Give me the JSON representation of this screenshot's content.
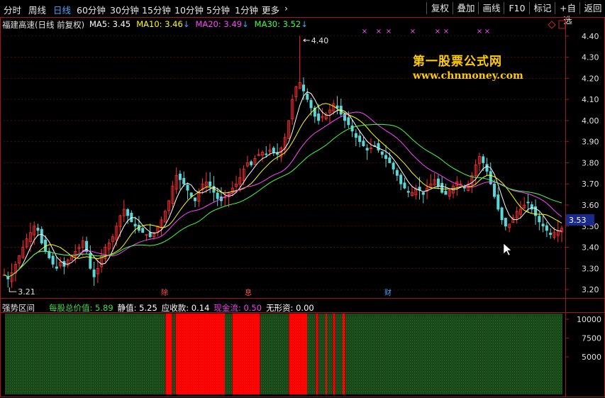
{
  "toolbar": {
    "tabs": [
      "分时",
      "周线",
      "日线",
      "60分钟",
      "30分钟",
      "15分钟",
      "10分钟",
      "5分钟",
      "1分钟",
      "更多"
    ],
    "active_tab": "日线",
    "more_arrow": "›",
    "right_buttons": [
      "复权",
      "叠加",
      "画线",
      "F10",
      "标记",
      "+自选",
      "返回"
    ]
  },
  "legend": {
    "stock": "福建高速(日线 前复权)",
    "ma": [
      {
        "label": "MA5:",
        "value": "3.45",
        "color": "#ffffff",
        "arrow": ""
      },
      {
        "label": "MA10:",
        "value": "3.46",
        "color": "#ffff00",
        "arrow": "↓"
      },
      {
        "label": "MA20:",
        "value": "3.49",
        "color": "#ff44ff",
        "arrow": "↓"
      },
      {
        "label": "MA30:",
        "value": "3.52",
        "color": "#44ff44",
        "arrow": "↓"
      }
    ]
  },
  "watermark": {
    "line1": "第一股票公式网",
    "line2": "www.chnmoney.com"
  },
  "lower_panel": {
    "title": "强势区间",
    "items": [
      {
        "label": "每股总价值:",
        "value": "5.89",
        "color": "#44dd44"
      },
      {
        "label": "静值:",
        "value": "5.25",
        "color": "#ffffff"
      },
      {
        "label": "应收款:",
        "value": "0.14",
        "color": "#ffffff"
      },
      {
        "label": "现金流:",
        "value": "0.50",
        "color": "#ee44ee"
      },
      {
        "label": "无形资:",
        "value": "0.00",
        "color": "#ffffff"
      }
    ]
  },
  "colors": {
    "up": "#ff3030",
    "down": "#5ad8d8",
    "axis": "#9a1b1b",
    "grid": "#5a1212",
    "text": "#e0e0e0",
    "bar_green": "#2a7a2a",
    "bar_red": "#ff0000"
  },
  "chart_data": [
    {
      "type": "candlestick",
      "title": "福建高速",
      "ylim": [
        3.16,
        4.47
      ],
      "y_ticks": [
        3.2,
        3.3,
        3.4,
        3.5,
        3.6,
        3.7,
        3.8,
        3.9,
        4.0,
        4.1,
        4.2,
        4.3,
        4.4
      ],
      "current_price": "3.53",
      "annotations": [
        {
          "label": "4.40",
          "value": 4.4
        },
        {
          "label": "3.21",
          "value": 3.21
        }
      ],
      "event_markers": [
        "除",
        "息",
        "财"
      ],
      "ma_series": [
        {
          "name": "MA5",
          "value": 3.45
        },
        {
          "name": "MA10",
          "value": 3.46
        },
        {
          "name": "MA20",
          "value": 3.49
        },
        {
          "name": "MA30",
          "value": 3.52
        }
      ],
      "closes": [
        3.27,
        3.25,
        3.28,
        3.32,
        3.36,
        3.4,
        3.44,
        3.47,
        3.5,
        3.48,
        3.42,
        3.38,
        3.35,
        3.32,
        3.3,
        3.33,
        3.31,
        3.34,
        3.36,
        3.38,
        3.4,
        3.43,
        3.38,
        3.3,
        3.26,
        3.3,
        3.36,
        3.4,
        3.42,
        3.45,
        3.5,
        3.55,
        3.58,
        3.55,
        3.52,
        3.5,
        3.48,
        3.47,
        3.46,
        3.45,
        3.47,
        3.5,
        3.53,
        3.57,
        3.62,
        3.69,
        3.74,
        3.72,
        3.7,
        3.67,
        3.64,
        3.62,
        3.66,
        3.7,
        3.71,
        3.69,
        3.66,
        3.63,
        3.62,
        3.64,
        3.66,
        3.68,
        3.7,
        3.73,
        3.77,
        3.8,
        3.79,
        3.82,
        3.84,
        3.85,
        3.84,
        3.86,
        3.85,
        3.84,
        3.87,
        3.92,
        4.0,
        4.1,
        4.16,
        4.18,
        4.14,
        4.1,
        4.06,
        4.02,
        4.0,
        4.02,
        4.03,
        4.05,
        4.08,
        4.06,
        4.03,
        4.0,
        3.98,
        3.95,
        3.92,
        3.9,
        3.88,
        3.86,
        3.87,
        3.88,
        3.86,
        3.84,
        3.82,
        3.8,
        3.77,
        3.74,
        3.7,
        3.68,
        3.66,
        3.66,
        3.68,
        3.67,
        3.65,
        3.68,
        3.7,
        3.72,
        3.69,
        3.66,
        3.65,
        3.67,
        3.69,
        3.71,
        3.7,
        3.68,
        3.7,
        3.74,
        3.79,
        3.83,
        3.8,
        3.76,
        3.7,
        3.64,
        3.58,
        3.53,
        3.5,
        3.51,
        3.54,
        3.57,
        3.58,
        3.6,
        3.61,
        3.58,
        3.55,
        3.52,
        3.5,
        3.48,
        3.46,
        3.47,
        3.48,
        3.49
      ]
    },
    {
      "type": "bar",
      "title": "强势区间",
      "y_ticks": [
        5000,
        7500,
        10000
      ],
      "bar_max": 10000,
      "red_segments": [
        [
          234,
          242
        ],
        [
          248,
          317
        ],
        [
          328,
          366
        ],
        [
          408,
          433
        ],
        [
          446,
          448
        ],
        [
          459,
          461
        ],
        [
          470,
          472
        ],
        [
          483,
          486
        ]
      ],
      "bar_range": [
        8,
        793
      ]
    }
  ]
}
